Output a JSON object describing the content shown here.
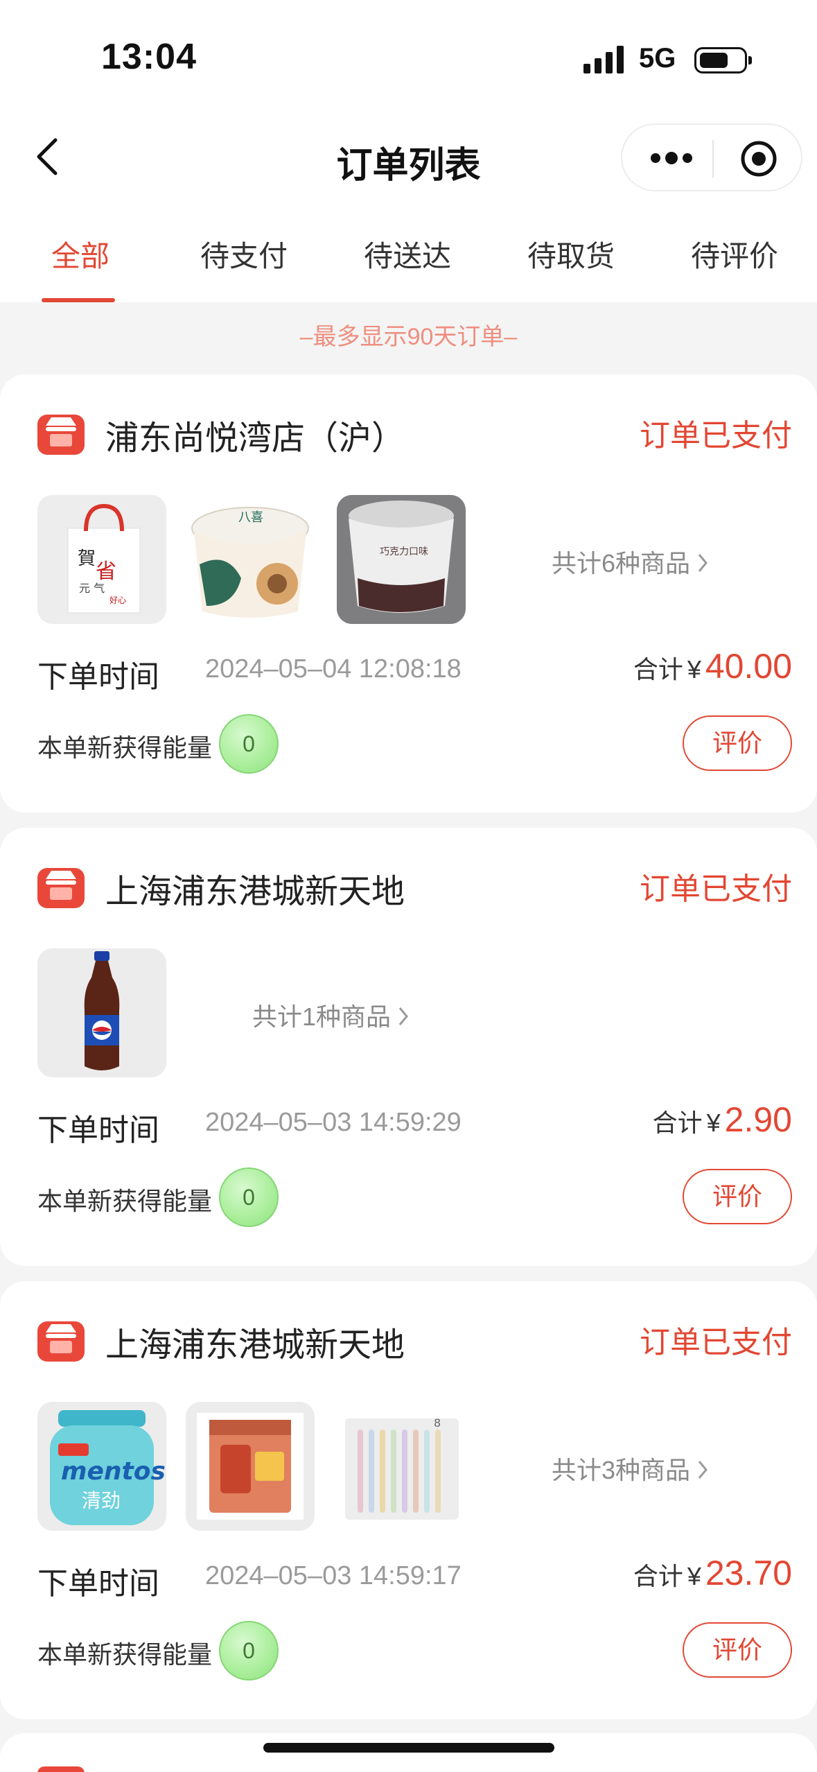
{
  "status_bar": {
    "time": "13:04",
    "network": "5G"
  },
  "nav": {
    "title": "订单列表"
  },
  "tabs": [
    {
      "label": "全部",
      "active": true
    },
    {
      "label": "待支付",
      "active": false
    },
    {
      "label": "待送达",
      "active": false
    },
    {
      "label": "待取货",
      "active": false
    },
    {
      "label": "待评价",
      "active": false
    }
  ],
  "notice": "–最多显示90天订单–",
  "labels": {
    "order_time": "下单时间",
    "total": "合计",
    "currency": "¥",
    "energy": "本单新获得能量",
    "rate_button": "评价"
  },
  "orders": [
    {
      "store": "浦东尚悦湾店（沪）",
      "status": "订单已支付",
      "items": [
        "gift-bag",
        "ice-cream-cup-white",
        "ice-cream-cup-gray"
      ],
      "count_text": "共计6种商品",
      "time": "2024–05–04 12:08:18",
      "amount": "40.00",
      "energy": "0"
    },
    {
      "store": "上海浦东港城新天地",
      "status": "订单已支付",
      "items": [
        "pepsi-bottle"
      ],
      "count_text": "共计1种商品",
      "time": "2024–05–03 14:59:29",
      "amount": "2.90",
      "energy": "0"
    },
    {
      "store": "上海浦东港城新天地",
      "status": "订单已支付",
      "items": [
        "mentos-bottle",
        "snack-pack",
        "toothbrush-set"
      ],
      "count_text": "共计3种商品",
      "time": "2024–05–03 14:59:17",
      "amount": "23.70",
      "energy": "0"
    }
  ],
  "colors": {
    "accent": "#e24733",
    "notice": "#ef8e7f",
    "energy_badge": "#a9ee9a"
  }
}
